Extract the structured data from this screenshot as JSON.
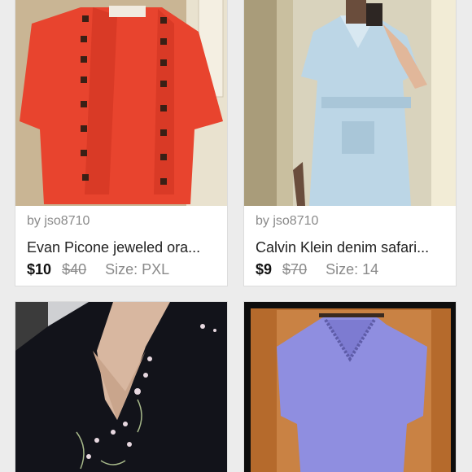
{
  "listings": [
    {
      "seller": "by jso8710",
      "title": "Evan Picone jeweled ora...",
      "price": "$10",
      "original_price": "$40",
      "size": "Size: PXL",
      "image": "orange-cardigan-photo"
    },
    {
      "seller": "by jso8710",
      "title": "Calvin Klein denim safari...",
      "price": "$9",
      "original_price": "$70",
      "size": "Size: 14",
      "image": "light-blue-safari-dress-photo"
    },
    {
      "image": "black-embroidered-top-photo"
    },
    {
      "image": "lavender-top-photo"
    }
  ],
  "colors": {
    "background": "#ececec",
    "card": "#ffffff",
    "muted_text": "#8a8a8a",
    "primary_text": "#222222"
  }
}
